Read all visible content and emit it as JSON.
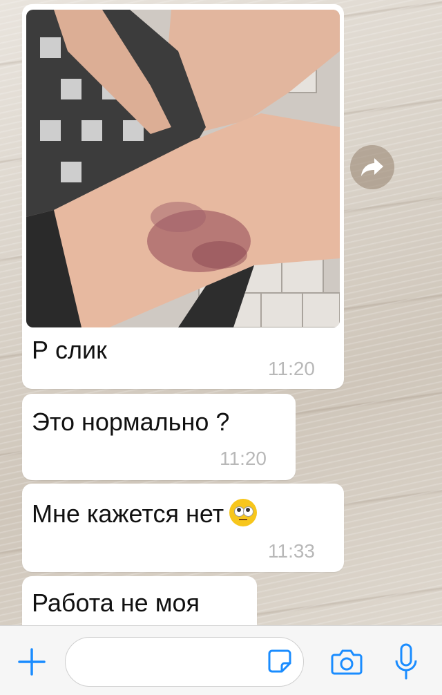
{
  "messages": [
    {
      "type": "photo",
      "caption": "Р слик",
      "time": "11:20"
    },
    {
      "type": "text",
      "text": "Это нормально ?",
      "time": "11:20"
    },
    {
      "type": "text",
      "text": "Мне кажется нет",
      "emoji": "face-with-rolling-eyes",
      "time": "11:33"
    },
    {
      "type": "text",
      "text": "Работа не моя"
    }
  ],
  "composer": {
    "placeholder": ""
  },
  "icons": {
    "attach": "plus-icon",
    "sticker": "sticker-icon",
    "camera": "camera-icon",
    "mic": "microphone-icon",
    "forward": "forward-icon"
  },
  "colors": {
    "accent": "#1a8cff",
    "bubble": "#ffffff",
    "time": "#b8b8b8"
  }
}
